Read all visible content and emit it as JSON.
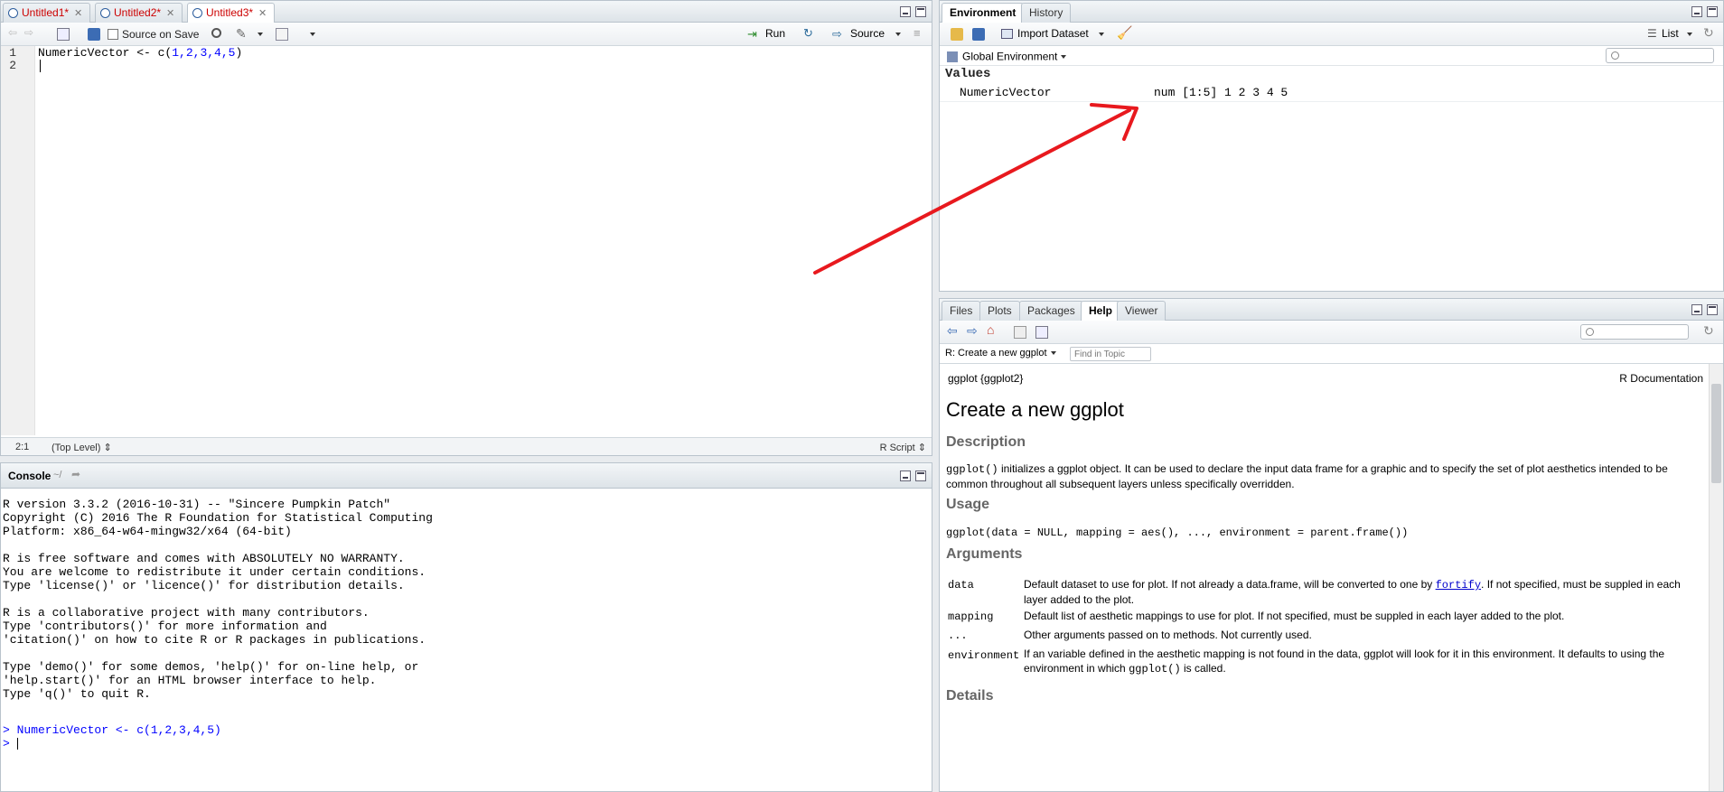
{
  "source_pane": {
    "tabs": [
      {
        "label": "Untitled1*",
        "active": false
      },
      {
        "label": "Untitled2*",
        "active": false
      },
      {
        "label": "Untitled3*",
        "active": true
      }
    ],
    "toolbar": {
      "source_on_save": "Source on Save",
      "run": "Run",
      "source": "Source"
    },
    "lines": [
      {
        "num": "1",
        "code_ident": "NumericVector",
        "code_op": " <- c(",
        "code_args": "1,2,3,4,5",
        "code_close": ")"
      },
      {
        "num": "2",
        "code_ident": "",
        "code_op": "",
        "code_args": "",
        "code_close": ""
      }
    ],
    "status": {
      "position": "2:1",
      "scope": "(Top Level)",
      "file_type": "R Script"
    }
  },
  "console_pane": {
    "title": "Console",
    "path": "~/",
    "output": "R version 3.3.2 (2016-10-31) -- \"Sincere Pumpkin Patch\"\nCopyright (C) 2016 The R Foundation for Statistical Computing\nPlatform: x86_64-w64-mingw32/x64 (64-bit)\n\nR is free software and comes with ABSOLUTELY NO WARRANTY.\nYou are welcome to redistribute it under certain conditions.\nType 'license()' or 'licence()' for distribution details.\n\nR is a collaborative project with many contributors.\nType 'contributors()' for more information and\n'citation()' on how to cite R or R packages in publications.\n\nType 'demo()' for some demos, 'help()' for on-line help, or\n'help.start()' for an HTML browser interface to help.\nType 'q()' to quit R.\n",
    "history_cmd": "> NumericVector <- c(1,2,3,4,5)",
    "prompt": "> "
  },
  "env_pane": {
    "tabs": [
      {
        "label": "Environment",
        "active": true
      },
      {
        "label": "History",
        "active": false
      }
    ],
    "import_dataset": "Import Dataset",
    "view_mode": "List",
    "scope": "Global Environment",
    "section": "Values",
    "variables": [
      {
        "name": "NumericVector",
        "value": "num [1:5] 1 2 3 4 5"
      }
    ]
  },
  "help_pane": {
    "tabs": [
      {
        "label": "Files",
        "active": false
      },
      {
        "label": "Plots",
        "active": false
      },
      {
        "label": "Packages",
        "active": false
      },
      {
        "label": "Help",
        "active": true
      },
      {
        "label": "Viewer",
        "active": false
      }
    ],
    "topic_select": "R: Create a new ggplot",
    "find_placeholder": "Find in Topic",
    "doc": {
      "pkg_label": "ggplot {ggplot2}",
      "doc_label": "R Documentation",
      "title": "Create a new ggplot",
      "description_heading": "Description",
      "description_code": "ggplot()",
      "description_text": " initializes a ggplot object. It can be used to declare the input data frame for a graphic and to specify the set of plot aesthetics intended to be common throughout all subsequent layers unless specifically overridden.",
      "usage_heading": "Usage",
      "usage_code": "ggplot(data = NULL, mapping = aes(), ..., environment = parent.frame())",
      "arguments_heading": "Arguments",
      "arguments": [
        {
          "name": "data",
          "pre": "Default dataset to use for plot. If not already a data.frame, will be converted to one by ",
          "link": "fortify",
          "post": ". If not specified, must be suppled in each layer added to the plot."
        },
        {
          "name": "mapping",
          "pre": "Default list of aesthetic mappings to use for plot. If not specified, must be suppled in each layer added to the plot.",
          "link": "",
          "post": ""
        },
        {
          "name": "...",
          "pre": "Other arguments passed on to methods. Not currently used.",
          "link": "",
          "post": ""
        },
        {
          "name": "environment",
          "pre": "If an variable defined in the aesthetic mapping is not found in the data, ggplot will look for it in this environment. It defaults to using the environment in which ",
          "code": "ggplot()",
          "post": " is called."
        }
      ],
      "details_heading": "Details"
    }
  },
  "annotation": {
    "arrow_color": "#e8191e"
  }
}
